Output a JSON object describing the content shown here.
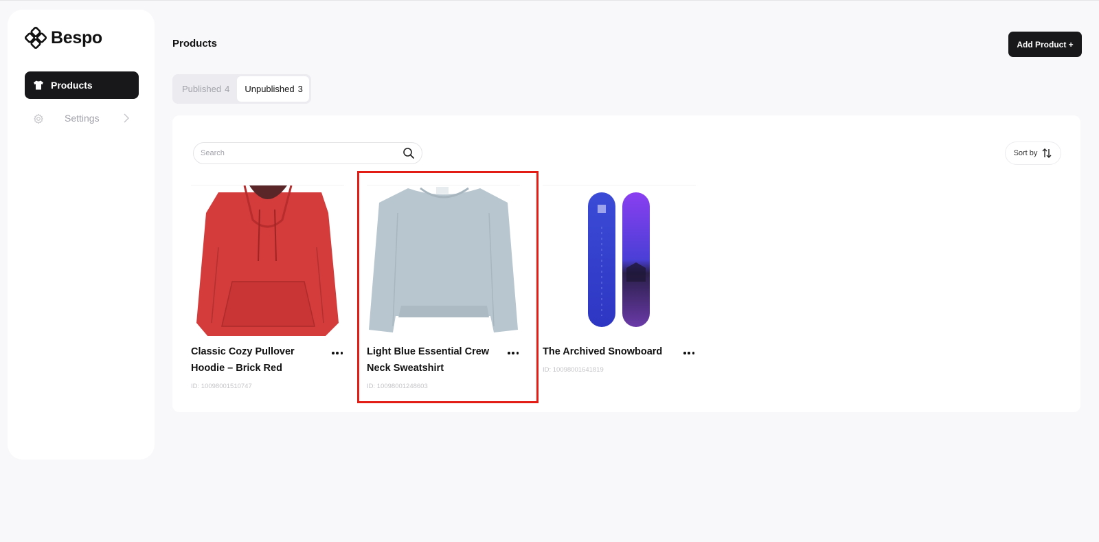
{
  "app": {
    "name": "Bespo"
  },
  "sidebar": {
    "items": [
      {
        "label": "Products",
        "icon": "shirt-icon",
        "active": true
      },
      {
        "label": "Settings",
        "icon": "gear-icon",
        "active": false
      }
    ]
  },
  "header": {
    "title": "Products",
    "add_label": "Add Product +"
  },
  "tabs": [
    {
      "label": "Published",
      "count": "4",
      "active": false
    },
    {
      "label": "Unpublished",
      "count": "3",
      "active": true
    }
  ],
  "search": {
    "placeholder": "Search",
    "value": ""
  },
  "sort": {
    "label": "Sort by"
  },
  "products": [
    {
      "title": "Classic Cozy Pullover Hoodie – Brick Red",
      "id": "ID: 10098001510747",
      "image": "red-hoodie",
      "color": "#d43b3b"
    },
    {
      "title": "Light Blue Essential Crew Neck Sweatshirt",
      "id": "ID: 10098001248603",
      "image": "light-blue-sweatshirt",
      "color": "#b8c6cf"
    },
    {
      "title": "The Archived Snowboard",
      "id": "ID: 10098001641819",
      "image": "snowboards",
      "color": "#3b3fd6"
    }
  ],
  "highlight": {
    "color": "#e11d16"
  }
}
